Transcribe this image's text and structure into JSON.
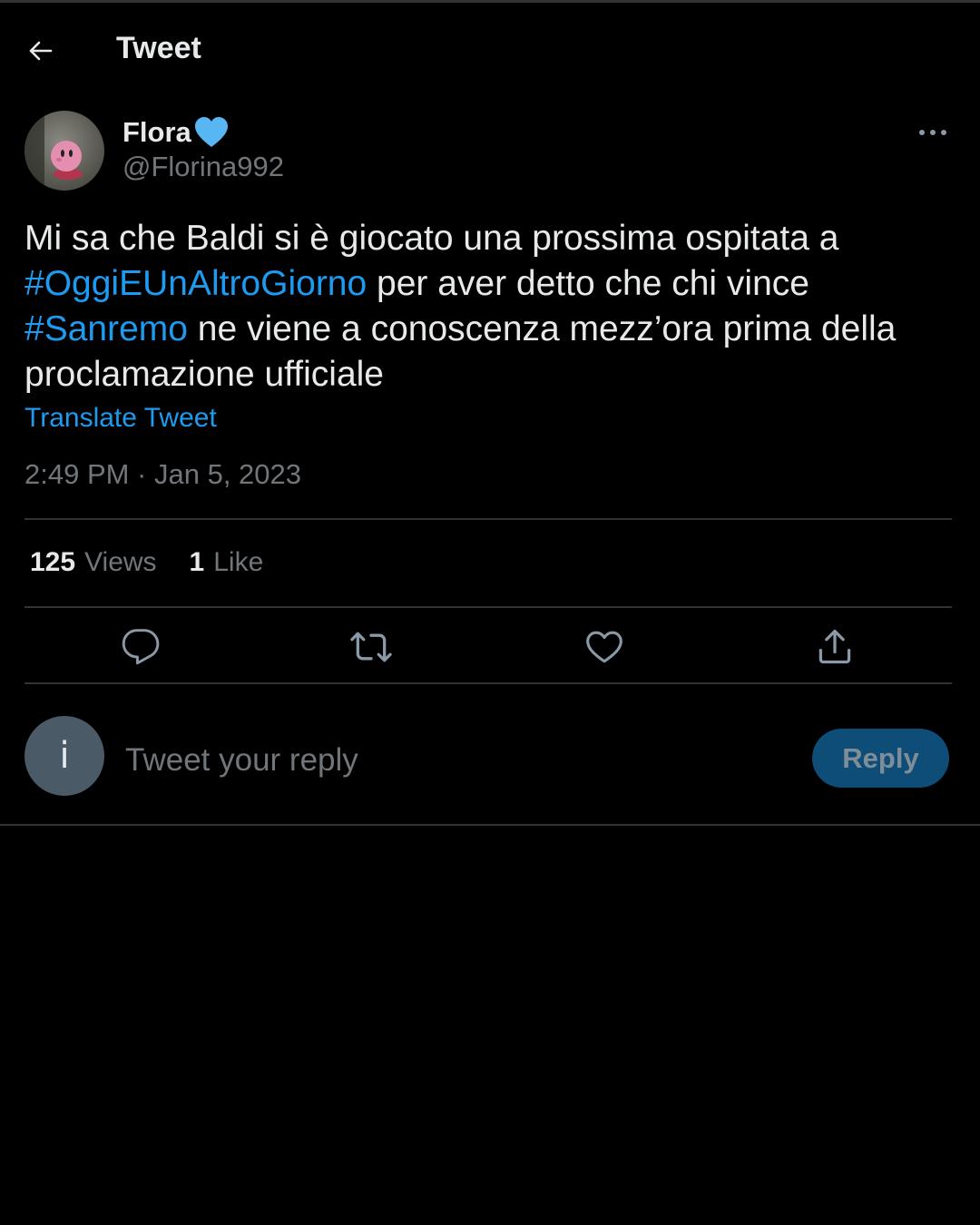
{
  "header": {
    "title": "Tweet",
    "back_icon": "arrow-left-icon"
  },
  "author": {
    "display_name": "Flora",
    "badge_emoji": "blue-heart-icon",
    "handle": "@Florina992"
  },
  "tweet": {
    "segments": [
      {
        "text": "Mi sa che Baldi si è giocato una prossima ospitata a ",
        "type": "text"
      },
      {
        "text": "#OggiEUnAltroGiorno",
        "type": "hashtag"
      },
      {
        "text": " per aver detto che chi vince ",
        "type": "text"
      },
      {
        "text": "#Sanremo",
        "type": "hashtag"
      },
      {
        "text": " ne viene a conoscenza mezz’ora prima della proclamazione ufficiale",
        "type": "text"
      }
    ],
    "translate_label": "Translate Tweet",
    "timestamp": "2:49 PM · Jan 5, 2023"
  },
  "stats": {
    "views_count": "125",
    "views_label": "Views",
    "likes_count": "1",
    "likes_label": "Like"
  },
  "actions": [
    "reply-icon",
    "retweet-icon",
    "like-icon",
    "share-icon"
  ],
  "reply_box": {
    "avatar_letter": "i",
    "placeholder": "Tweet your reply",
    "button_label": "Reply"
  },
  "colors": {
    "background": "#000000",
    "accent": "#1d9bf0",
    "muted_text": "#71767b",
    "reply_button": "#0e4d78"
  }
}
